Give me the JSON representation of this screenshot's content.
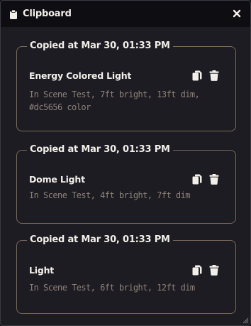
{
  "window": {
    "title": "Clipboard",
    "title_icon": "clipboard-icon",
    "close_icon": "close-icon"
  },
  "entries": [
    {
      "copied_label": "Copied at Mar 30, 01:33 PM",
      "name": "Energy Colored Light",
      "description": "In Scene Test, 7ft bright, 13ft dim, #dc5656 color"
    },
    {
      "copied_label": "Copied at Mar 30, 01:33 PM",
      "name": "Dome Light",
      "description": "In Scene Test, 4ft bright, 7ft dim"
    },
    {
      "copied_label": "Copied at Mar 30, 01:33 PM",
      "name": "Light",
      "description": "In Scene Test, 6ft bright, 12ft dim"
    }
  ],
  "entry_icons": {
    "copy": "copy-icon",
    "delete": "trash-icon"
  },
  "colors": {
    "background": "#1d1c22",
    "titlebar": "#0e0e12",
    "border": "#7a6a5c",
    "text": "#f2efe9",
    "muted": "#8c8178"
  }
}
